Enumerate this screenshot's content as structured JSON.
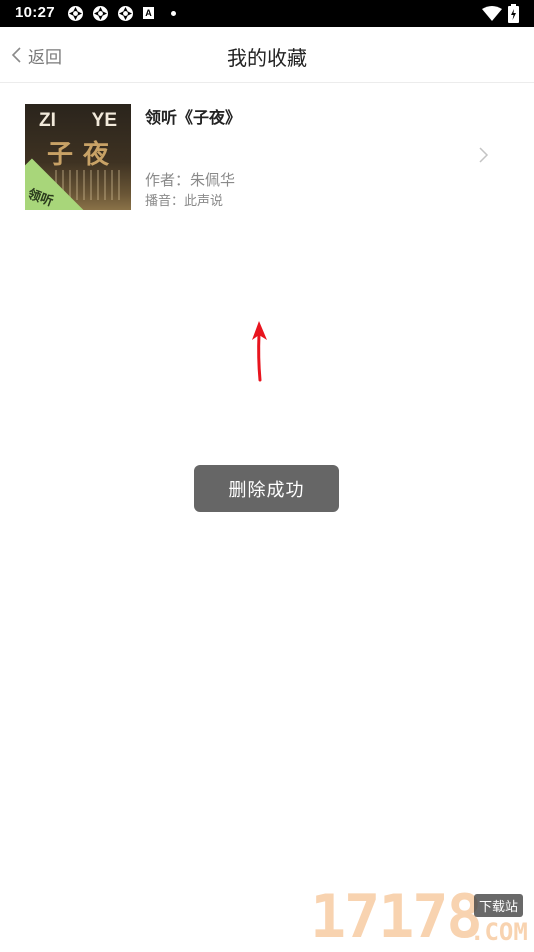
{
  "status_bar": {
    "time": "10:27",
    "notification_icons": [
      "app-notification-icon",
      "app-notification-icon",
      "app-notification-icon"
    ],
    "small_icon_letter": "A"
  },
  "nav": {
    "back_label": "返回",
    "title": "我的收藏"
  },
  "favorites": [
    {
      "cover": {
        "top_left": "ZI",
        "top_right": "YE",
        "big_text": "子夜",
        "badge": "领听"
      },
      "title": "领听《子夜》",
      "author": "作者：朱佩华",
      "narrator": "播音：此声说"
    }
  ],
  "toast": {
    "message": "删除成功"
  },
  "watermark": {
    "number": "17178",
    "tag": "下载站",
    "suffix": ".COM"
  },
  "colors": {
    "arrow": "#e8141e",
    "toast_bg": "#666666",
    "cover_badge": "#a8d67a"
  }
}
